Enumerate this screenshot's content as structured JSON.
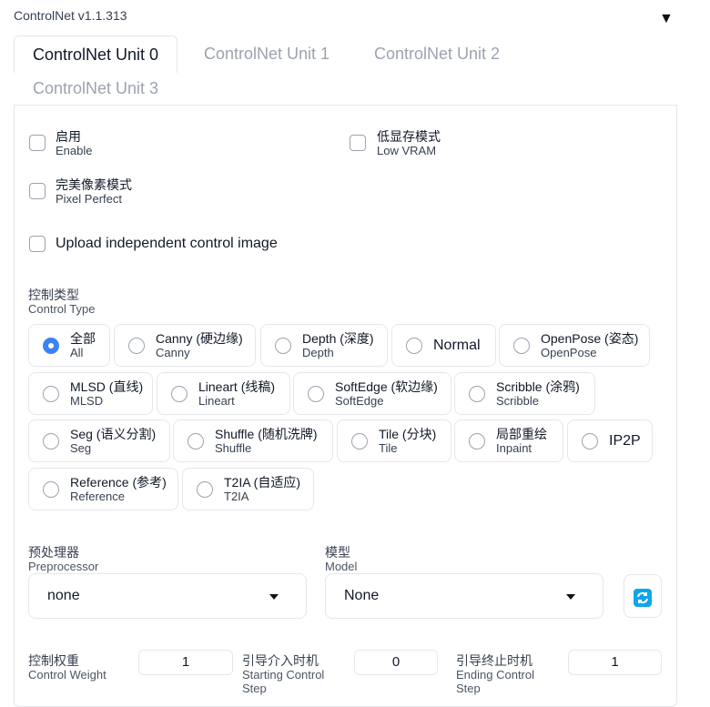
{
  "app": {
    "title": "ControlNet v1.1.313",
    "toggle": "▼"
  },
  "tabs": [
    {
      "label": "ControlNet Unit 0"
    },
    {
      "label": "ControlNet Unit 1"
    },
    {
      "label": "ControlNet Unit 2"
    },
    {
      "label": "ControlNet Unit 3"
    }
  ],
  "checks": {
    "enable": {
      "zh": "启用",
      "en": "Enable",
      "checked": false
    },
    "low_vram": {
      "zh": "低显存模式",
      "en": "Low VRAM",
      "checked": false
    },
    "pixel_perfect": {
      "zh": "完美像素模式",
      "en": "Pixel Perfect",
      "checked": false
    },
    "upload_independent": {
      "label": "Upload independent control image",
      "checked": false
    }
  },
  "control_type": {
    "label_zh": "控制类型",
    "label_en": "Control Type",
    "selected": "All",
    "options": [
      {
        "zh": "全部",
        "en": "All"
      },
      {
        "zh": "Canny (硬边缘)",
        "en": "Canny"
      },
      {
        "zh": "Depth (深度)",
        "en": "Depth"
      },
      {
        "zh": "Normal",
        "en": ""
      },
      {
        "zh": "OpenPose (姿态)",
        "en": "OpenPose"
      },
      {
        "zh": "MLSD (直线)",
        "en": "MLSD"
      },
      {
        "zh": "Lineart (线稿)",
        "en": "Lineart"
      },
      {
        "zh": "SoftEdge (软边缘)",
        "en": "SoftEdge"
      },
      {
        "zh": "Scribble (涂鸦)",
        "en": "Scribble"
      },
      {
        "zh": "Seg (语义分割)",
        "en": "Seg"
      },
      {
        "zh": "Shuffle (随机洗牌)",
        "en": "Shuffle"
      },
      {
        "zh": "Tile (分块)",
        "en": "Tile"
      },
      {
        "zh": "局部重绘",
        "en": "Inpaint"
      },
      {
        "zh": "IP2P",
        "en": ""
      },
      {
        "zh": "Reference (参考)",
        "en": "Reference"
      },
      {
        "zh": "T2IA (自适应)",
        "en": "T2IA"
      }
    ]
  },
  "preprocessor": {
    "label_zh": "预处理器",
    "label_en": "Preprocessor",
    "value": "none"
  },
  "model": {
    "label_zh": "模型",
    "label_en": "Model",
    "value": "None"
  },
  "refresh_icon": "refresh-icon",
  "sliders": {
    "weight": {
      "label_zh": "控制权重",
      "label_en": "Control Weight",
      "value": "1"
    },
    "start": {
      "label_zh": "引导介入时机",
      "label_en": "Starting Control Step",
      "value": "0"
    },
    "end": {
      "label_zh": "引导终止时机",
      "label_en": "Ending Control Step",
      "value": "1"
    }
  },
  "colors": {
    "accent": "#3b82f6",
    "refresh": "#0ea5e9",
    "border": "#e5e7eb"
  }
}
